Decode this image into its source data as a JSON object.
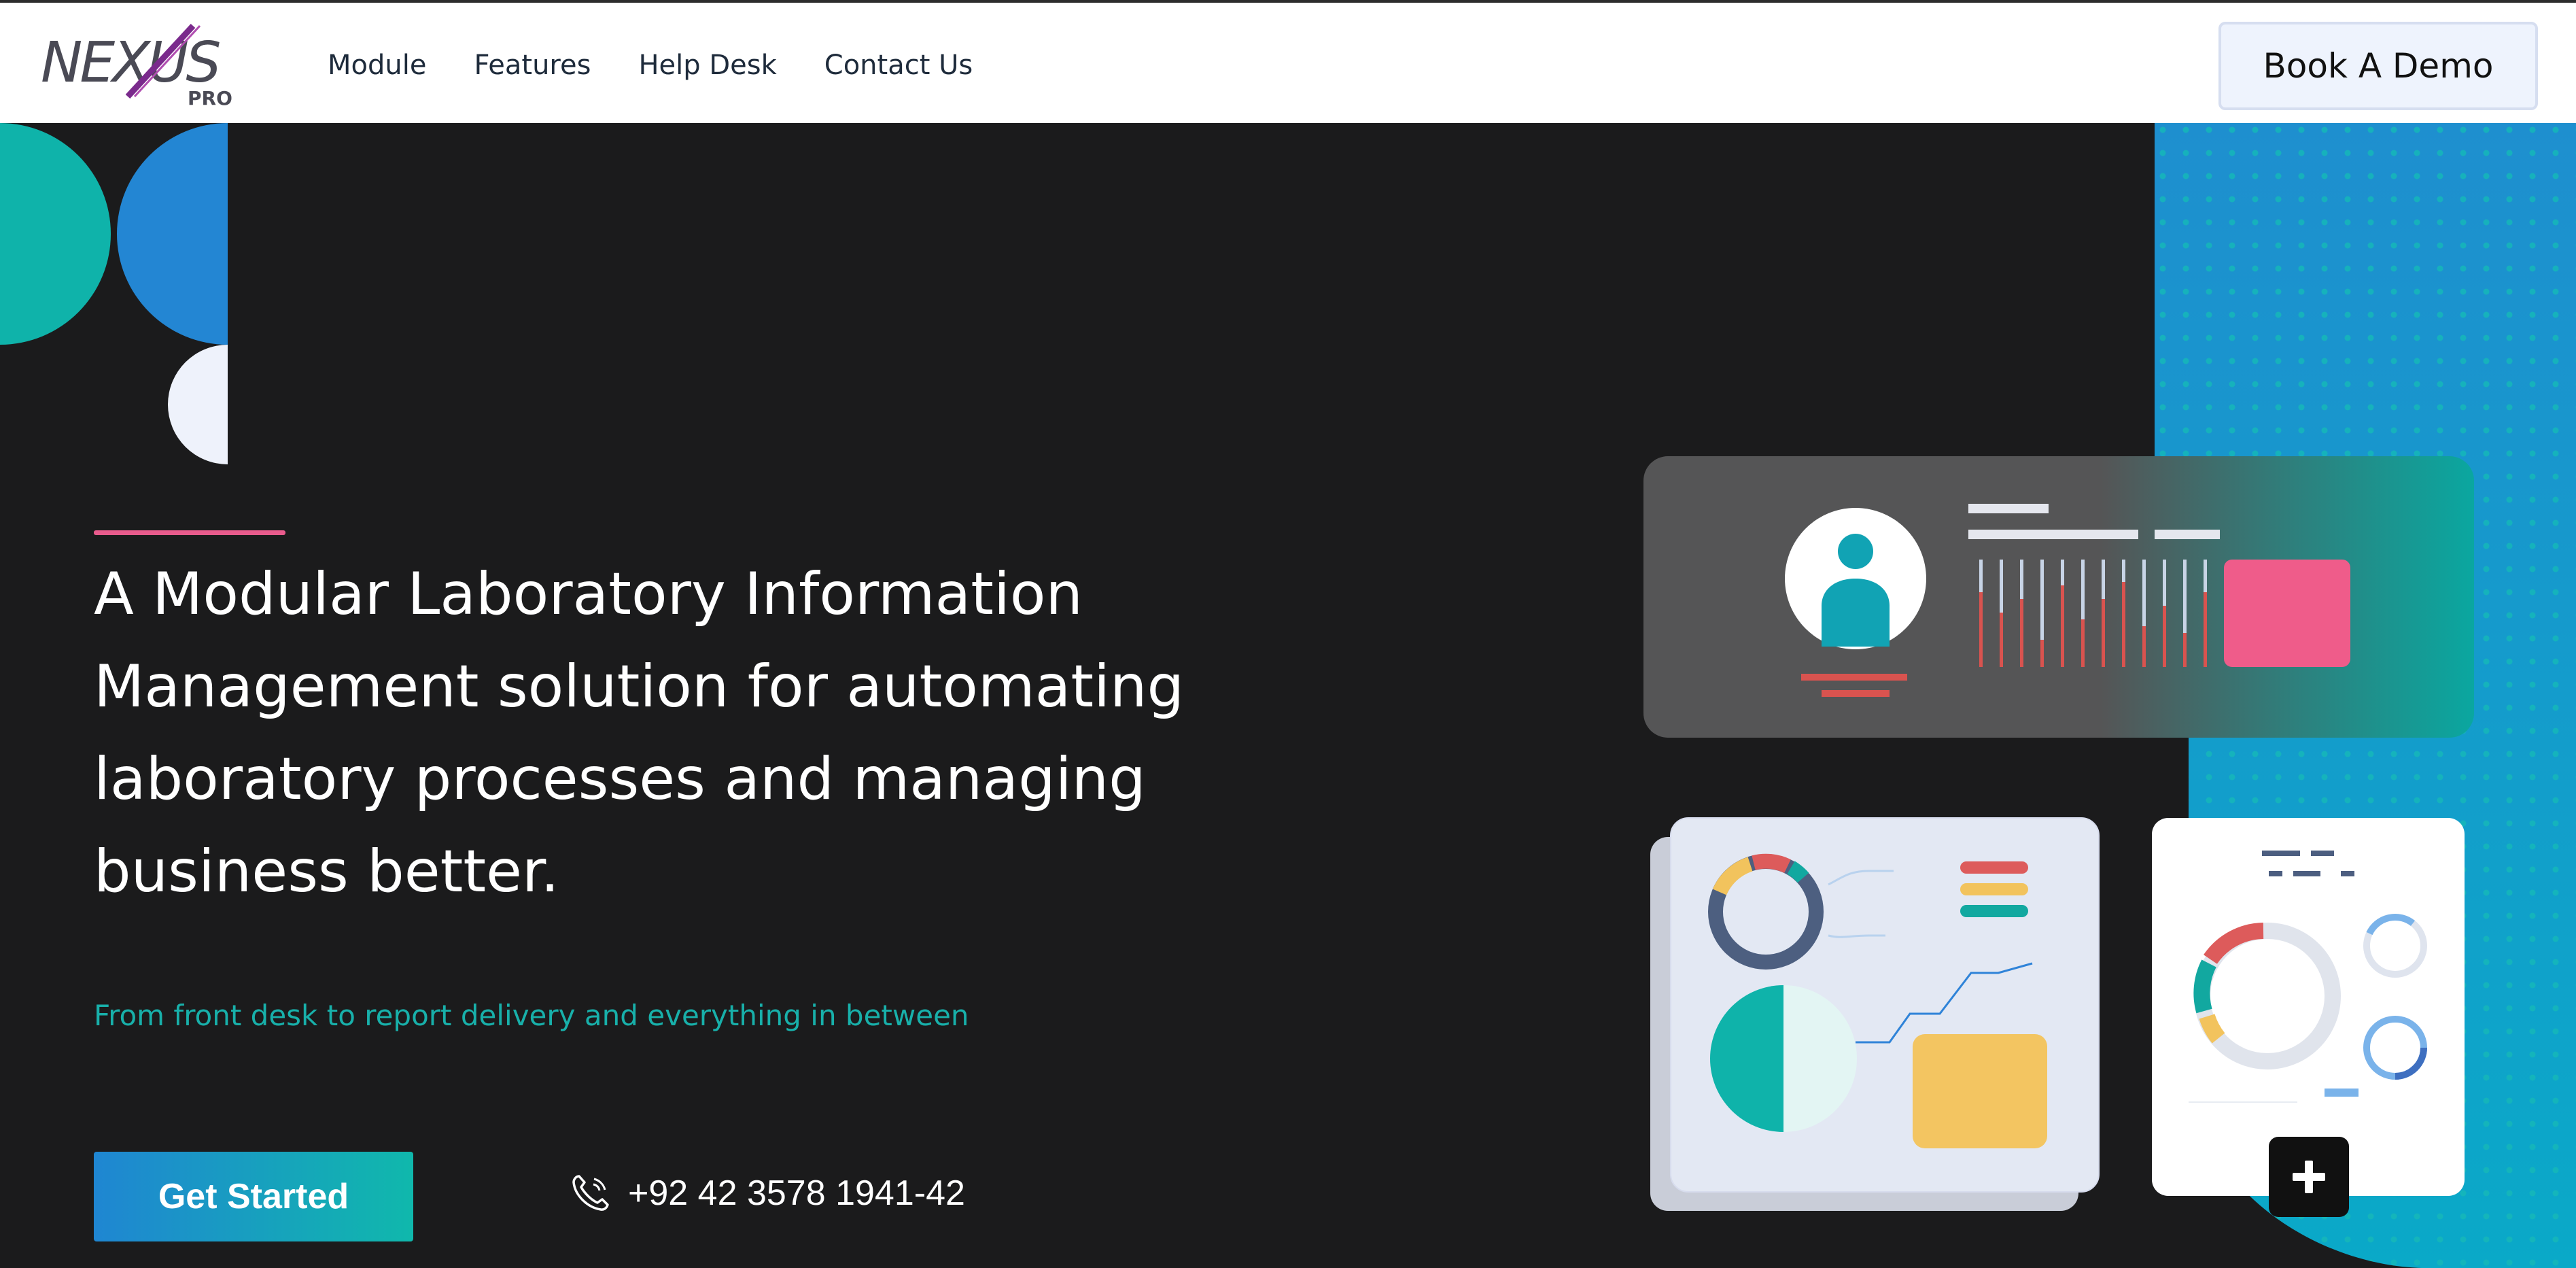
{
  "header": {
    "logo_text": "NEXUS",
    "logo_subtext": "PRO",
    "nav": [
      "Module",
      "Features",
      "Help Desk",
      "Contact Us"
    ],
    "demo_label": "Book A Demo"
  },
  "hero": {
    "headline_lines": [
      "A Modular Laboratory Information",
      "Management solution for automating",
      "laboratory processes and managing",
      "business better."
    ],
    "subline": "From front desk to report delivery and everything in between",
    "cta_label": "Get Started",
    "phone": "+92 42 3578 1941-42"
  },
  "colors": {
    "background": "#1b1b1c",
    "teal": "#0fb3aa",
    "blue": "#2185d4",
    "pink": "#e95b8c",
    "logo_purple": "#8a2a8e"
  },
  "icons": [
    "phone-icon",
    "user-avatar-icon",
    "plus-icon"
  ]
}
